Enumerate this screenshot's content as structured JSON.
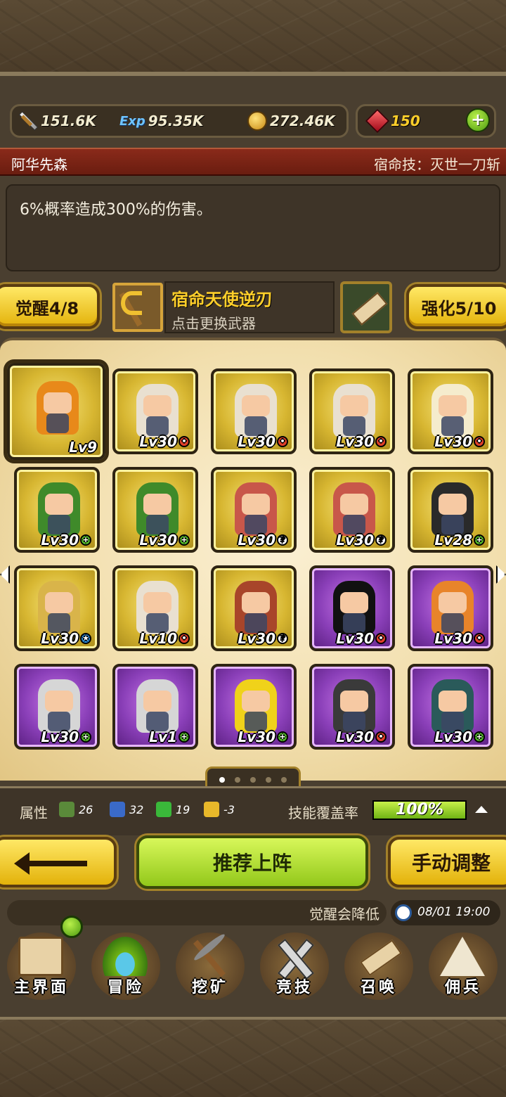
{
  "resources": {
    "attack": "151.6K",
    "exp_icon_text": "Exp",
    "exp": "95.35K",
    "gold": "272.46K",
    "gems": "150"
  },
  "hero": {
    "name": "阿华先森",
    "skill": "宿命技：灭世一刀斩",
    "description": "6%概率造成300%的伤害。"
  },
  "awaken_label": "觉醒4/8",
  "strengthen_label": "强化5/10",
  "weapon": {
    "name": "宿命天使逆刃",
    "hint": "点击更换武器"
  },
  "cards": [
    {
      "lv": "Lv9",
      "rarity": "gold",
      "badge": "none",
      "hair": "#e8891a",
      "selected": true
    },
    {
      "lv": "Lv30",
      "rarity": "gold",
      "badge": "red",
      "hair": "#e9e0d0"
    },
    {
      "lv": "Lv30",
      "rarity": "gold",
      "badge": "red",
      "hair": "#e9e0d0"
    },
    {
      "lv": "Lv30",
      "rarity": "gold",
      "badge": "red",
      "hair": "#e9e0d0"
    },
    {
      "lv": "Lv30",
      "rarity": "gold",
      "badge": "red",
      "hair": "#f5eccd"
    },
    {
      "lv": "Lv30",
      "rarity": "gold",
      "badge": "green",
      "hair": "#3f8a2a"
    },
    {
      "lv": "Lv30",
      "rarity": "gold",
      "badge": "green",
      "hair": "#3f8a2a"
    },
    {
      "lv": "Lv30",
      "rarity": "gold",
      "badge": "white",
      "hair": "#c8574a"
    },
    {
      "lv": "Lv30",
      "rarity": "gold",
      "badge": "white",
      "hair": "#c8574a"
    },
    {
      "lv": "Lv28",
      "rarity": "gold",
      "badge": "green",
      "hair": "#2a2a2a"
    },
    {
      "lv": "Lv30",
      "rarity": "gold",
      "badge": "blue",
      "hair": "#d9b44a"
    },
    {
      "lv": "Lv10",
      "rarity": "gold",
      "badge": "red",
      "hair": "#e9e0d0"
    },
    {
      "lv": "Lv30",
      "rarity": "gold",
      "badge": "white",
      "hair": "#a8452a"
    },
    {
      "lv": "Lv30",
      "rarity": "purple",
      "badge": "red",
      "hair": "#111111"
    },
    {
      "lv": "Lv30",
      "rarity": "purple",
      "badge": "red",
      "hair": "#e8842a"
    },
    {
      "lv": "Lv30",
      "rarity": "purple",
      "badge": "green",
      "hair": "#d6d6d6"
    },
    {
      "lv": "Lv1",
      "rarity": "purple",
      "badge": "green",
      "hair": "#d6d6d6"
    },
    {
      "lv": "Lv30",
      "rarity": "purple",
      "badge": "green",
      "hair": "#f0d21a"
    },
    {
      "lv": "Lv30",
      "rarity": "purple",
      "badge": "red",
      "hair": "#3a3a3a"
    },
    {
      "lv": "Lv30",
      "rarity": "purple",
      "badge": "green",
      "hair": "#2a5a5a"
    }
  ],
  "attributes": {
    "label": "属性",
    "values": [
      "26",
      "32",
      "19",
      "-3"
    ],
    "colors": [
      "#5a8a3a",
      "#3a6ac8",
      "#3ab83a",
      "#e8b82a"
    ]
  },
  "coverage": {
    "label": "技能覆盖率",
    "value": "100%",
    "fraction": 1.0
  },
  "buttons": {
    "recommend": "推荐上阵",
    "manual": "手动调整"
  },
  "ticker": "觉醒会降低",
  "datetime": "08/01 19:00",
  "nav": [
    "主界面",
    "冒险",
    "挖矿",
    "竞技",
    "召唤",
    "佣兵"
  ],
  "colors": {
    "gold_button": "#f2cb26",
    "green_button": "#b5e43a",
    "red_bar": "#7a2414"
  }
}
